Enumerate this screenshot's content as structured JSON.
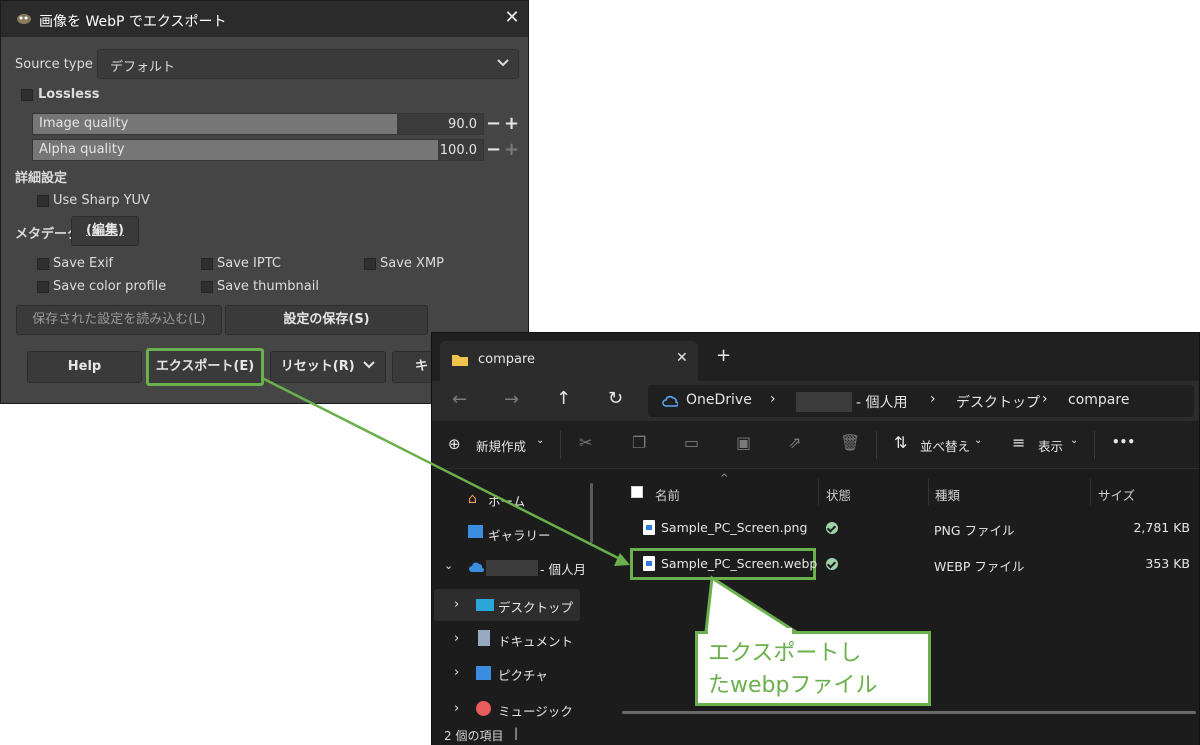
{
  "gimp": {
    "title": "画像を WebP でエクスポート",
    "source_type_label": "Source type",
    "source_type_value": "デフォルト",
    "lossless_label": "Lossless",
    "image_quality": {
      "label": "Image quality",
      "value": "90.0",
      "fraction": 0.9
    },
    "alpha_quality": {
      "label": "Alpha quality",
      "value": "100.0",
      "fraction": 1.0
    },
    "advanced_label": "詳細設定",
    "use_sharp_yuv": "Use Sharp YUV",
    "metadata_label": "メタデータ",
    "edit_button": "(編集)",
    "save_exif": "Save Exif",
    "save_iptc": "Save IPTC",
    "save_xmp": "Save XMP",
    "save_color_profile": "Save color profile",
    "save_thumbnail": "Save thumbnail",
    "load_defaults_button": "保存された設定を読み込む(L)",
    "save_defaults_button": "設定の保存(S)",
    "help_button": "Help",
    "export_button": "エクスポート(E)",
    "reset_button": "リセット(R)",
    "cancel_button_partial": "キ"
  },
  "explorer": {
    "tab_title": "compare",
    "new_tab": "+",
    "breadcrumb": [
      "OneDrive",
      "- 個人用",
      "デスクトップ",
      "compare"
    ],
    "cmd": {
      "new": "新規作成",
      "sort": "並べ替え",
      "view": "表示",
      "more": "•••"
    },
    "nav": [
      {
        "label": "ホーム"
      },
      {
        "label": "ギャラリー"
      },
      {
        "label": "- 個人月"
      },
      {
        "label": "デスクトップ"
      },
      {
        "label": "ドキュメント"
      },
      {
        "label": "ピクチャ"
      },
      {
        "label": "ミュージック"
      }
    ],
    "columns": {
      "name": "名前",
      "status": "状態",
      "type": "種類",
      "size": "サイズ"
    },
    "files": [
      {
        "name": "Sample_PC_Screen.png",
        "type": "PNG ファイル",
        "size": "2,781 KB"
      },
      {
        "name": "Sample_PC_Screen.webp",
        "type": "WEBP ファイル",
        "size": "353 KB"
      }
    ],
    "status_text": "2 個の項目"
  },
  "callout": {
    "line1": "エクスポートし",
    "line2": "たwebpファイル"
  },
  "colors": {
    "highlight": "#6ab04c",
    "accent": "#2f7be0"
  }
}
